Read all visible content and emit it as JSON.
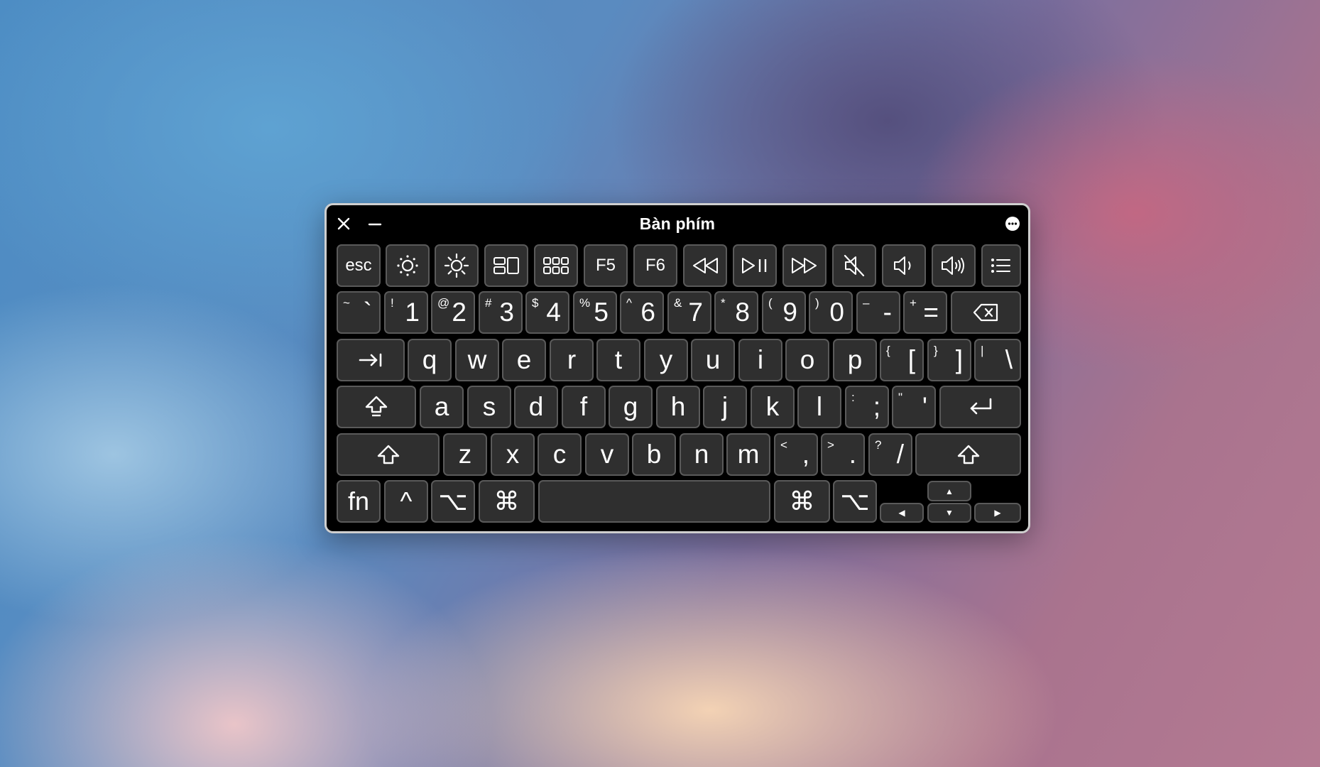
{
  "window": {
    "title": "Bàn phím",
    "close_icon": "close-icon",
    "minimize_icon": "minimize-icon",
    "more_icon": "more-options-icon"
  },
  "function_row": [
    {
      "label": "esc"
    },
    {
      "icon": "brightness-down-icon"
    },
    {
      "icon": "brightness-up-icon"
    },
    {
      "icon": "mission-control-icon"
    },
    {
      "icon": "launchpad-icon"
    },
    {
      "label": "F5"
    },
    {
      "label": "F6"
    },
    {
      "icon": "rewind-icon"
    },
    {
      "icon": "play-pause-icon"
    },
    {
      "icon": "fast-forward-icon"
    },
    {
      "icon": "mute-icon"
    },
    {
      "icon": "volume-down-icon"
    },
    {
      "icon": "volume-up-icon"
    },
    {
      "icon": "menu-list-icon"
    }
  ],
  "number_row": [
    {
      "shift": "~",
      "main": "`"
    },
    {
      "shift": "!",
      "main": "1"
    },
    {
      "shift": "@",
      "main": "2"
    },
    {
      "shift": "#",
      "main": "3"
    },
    {
      "shift": "$",
      "main": "4"
    },
    {
      "shift": "%",
      "main": "5"
    },
    {
      "shift": "^",
      "main": "6"
    },
    {
      "shift": "&",
      "main": "7"
    },
    {
      "shift": "*",
      "main": "8"
    },
    {
      "shift": "(",
      "main": "9"
    },
    {
      "shift": ")",
      "main": "0"
    },
    {
      "shift": "–",
      "main": "-"
    },
    {
      "shift": "+",
      "main": "="
    }
  ],
  "top_row": [
    "q",
    "w",
    "e",
    "r",
    "t",
    "y",
    "u",
    "i",
    "o",
    "p"
  ],
  "top_row_symbols": [
    {
      "shift": "{",
      "main": "["
    },
    {
      "shift": "}",
      "main": "]"
    },
    {
      "shift": "|",
      "main": "\\"
    }
  ],
  "home_row": [
    "a",
    "s",
    "d",
    "f",
    "g",
    "h",
    "j",
    "k",
    "l"
  ],
  "home_row_symbols": [
    {
      "shift": ":",
      "main": ";"
    },
    {
      "shift": "\"",
      "main": "'"
    }
  ],
  "bottom_row": [
    "z",
    "x",
    "c",
    "v",
    "b",
    "n",
    "m"
  ],
  "bottom_row_symbols": [
    {
      "shift": "<",
      "main": ","
    },
    {
      "shift": ">",
      "main": "."
    },
    {
      "shift": "?",
      "main": "/"
    }
  ],
  "modifier_row": {
    "fn": "fn",
    "control": "^",
    "option": "⌥",
    "command": "⌘",
    "up": "▲",
    "down": "▼",
    "left": "◀",
    "right": "▶"
  },
  "icons": {
    "delete": "delete-backward-icon",
    "tab": "tab-icon",
    "caps_lock": "caps-lock-icon",
    "return": "return-icon",
    "shift": "shift-icon"
  }
}
